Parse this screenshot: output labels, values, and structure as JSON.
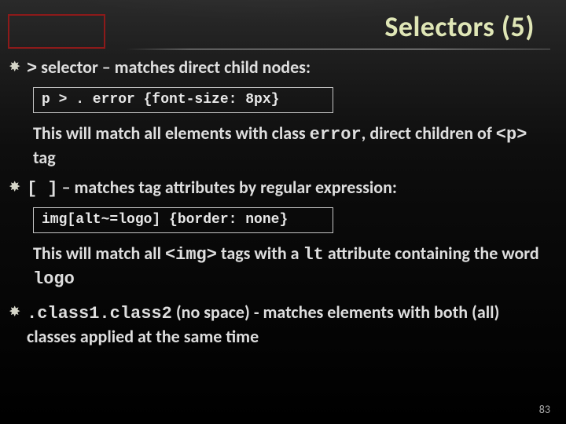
{
  "title": "Selectors (5)",
  "bullets": {
    "b1": {
      "sel": ">",
      "rest": " selector – matches direct child nodes:"
    },
    "b2_pre": "[ ]",
    "b2_rest": " – matches tag attributes by regular expression:",
    "b3_sel": ".class1.class2",
    "b3_rest": " (no space) - matches elements with both (all) classes applied at the same time"
  },
  "code1": "p > . error {font-size: 8px}",
  "expl1_a": "This will match all elements with class ",
  "expl1_b": "error",
  "expl1_c": ", direct children of ",
  "expl1_d": "<p>",
  "expl1_e": " tag",
  "code2": "img[alt~=logo] {border: none}",
  "expl2_a": "This will match all ",
  "expl2_b": "<img>",
  "expl2_c": " tags with a ",
  "expl2_d": "lt",
  "expl2_e": " attribute containing the word ",
  "expl2_f": "logo",
  "slide_number": "83"
}
